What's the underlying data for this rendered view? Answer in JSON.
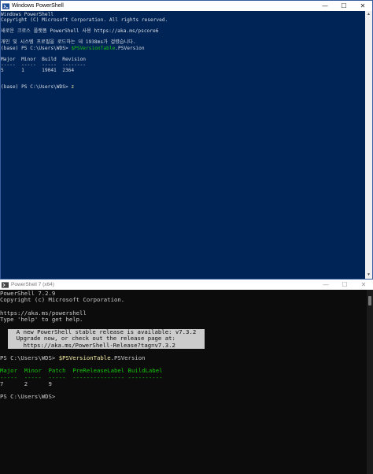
{
  "win1": {
    "title": "Windows PowerShell",
    "lines": [
      "Windows PowerShell",
      "Copyright (C) Microsoft Corporation. All rights reserved.",
      "",
      "새로운 크로스 플랫폼 PowerShell 사용 https://aka.ms/pscore6",
      "",
      "개인 및 시스템 프로필을 로드하는 데 1938ms가 걸렸습니다.",
      "(base) PS C:\\Users\\WDS> "
    ],
    "cmd1": "$PSVersionTable",
    "cmd1_rest": ".PSVersion",
    "header": "Major  Minor  Build  Revision",
    "underline": "-----  -----  -----  --------",
    "values": "5      1      19041  2364",
    "prompt2": "(base) PS C:\\Users\\WDS> ",
    "cmd2": "z"
  },
  "win2": {
    "title": "PowerShell 7 (x64)",
    "lines_a": [
      "PowerShell 7.2.9",
      "Copyright (c) Microsoft Corporation.",
      "",
      "https://aka.ms/powershell",
      "Type 'help' to get help.",
      ""
    ],
    "notice": [
      "  A new PowerShell stable release is available: v7.3.2  ",
      "  Upgrade now, or check out the release page at:        ",
      "    https://aka.ms/PowerShell-Release?tag=v7.3.2        "
    ],
    "prompt1": "PS C:\\Users\\WDS> ",
    "cmd1": "$PSVersionTable",
    "cmd1_rest": ".PSVersion",
    "header": "Major  Minor  Patch  PreReleaseLabel BuildLabel",
    "underline": "-----  -----  -----  --------------- ----------",
    "values": "7      2      9",
    "prompt2": "PS C:\\Users\\WDS>"
  },
  "caption": {
    "minimize": "—",
    "maximize": "☐",
    "close": "✕"
  },
  "colors": {
    "ps5_bg": "#012456",
    "ps7_bg": "#0c0c0c"
  }
}
